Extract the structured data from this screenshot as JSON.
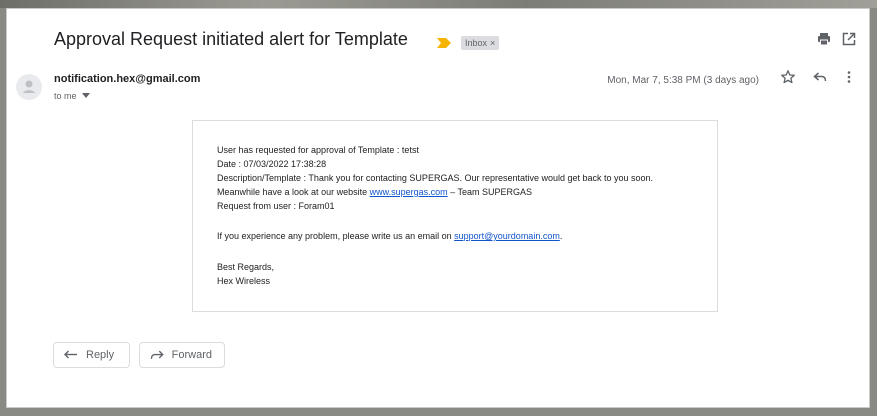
{
  "email": {
    "subject": "Approval Request initiated alert for Template",
    "label": "Inbox",
    "label_remove": "×",
    "sender": "notification.hex@gmail.com",
    "recipient": "to me",
    "date": "Mon, Mar 7, 5:38 PM (3 days ago)"
  },
  "header_icons": [
    "print-icon",
    "open-in-new-window-icon"
  ],
  "toolbar_icons": [
    "star-icon",
    "reply-icon",
    "more-options-icon"
  ],
  "body": {
    "line1": "User has requested for approval of Template : tetst",
    "line2": "Date : 07/03/2022 17:38:28",
    "line3": "Description/Template : Thank you for contacting SUPERGAS. Our representative would get back to you soon.",
    "line4_prefix": "Meanwhile have a look at our website ",
    "line4_link": "www.supergas.com",
    "line4_suffix": " – Team SUPERGAS",
    "line5": "Request from user : Foram01",
    "line6_prefix": "If you experience any problem, please write us an email on ",
    "line6_link": "support@yourdomain.com",
    "line6_suffix": ".",
    "line7": "Best Regards,",
    "line8": "Hex Wireless"
  },
  "actions": {
    "reply": "Reply",
    "forward": "Forward"
  },
  "colors": {
    "link": "#1155cc",
    "important_marker": "#f4b400",
    "label_bg": "#dadce0"
  }
}
